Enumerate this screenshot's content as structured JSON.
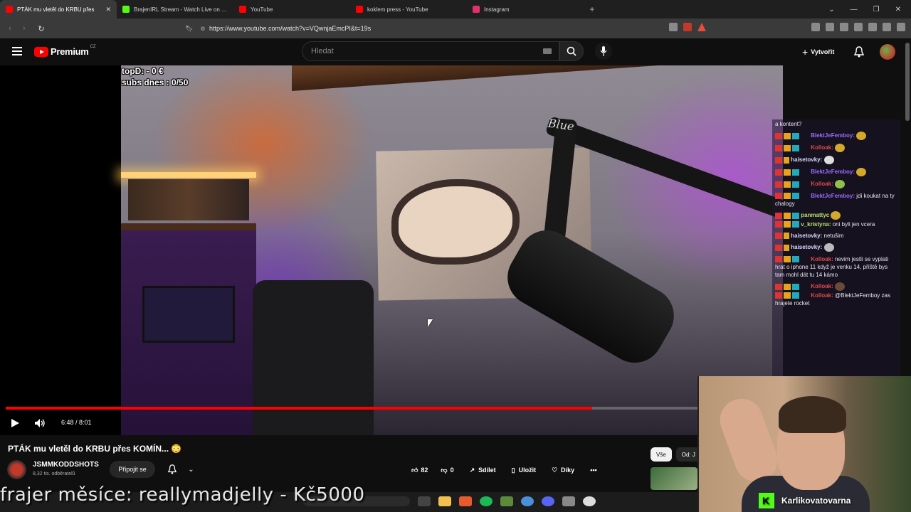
{
  "browser": {
    "tabs": [
      {
        "label": "PTÁK mu vletěl do KRBU přes",
        "favicon_color": "#ff0000",
        "active": true
      },
      {
        "label": "BrajenIRL Stream - Watch Live on Kick",
        "favicon_color": "#53fc18",
        "active": false
      },
      {
        "label": "YouTube",
        "favicon_color": "#ff0000",
        "active": false
      },
      {
        "label": "koklem press - YouTube",
        "favicon_color": "#ff0000",
        "active": false
      },
      {
        "label": "Instagram",
        "favicon_color": "#e1306c",
        "active": false
      }
    ],
    "new_tab": "+",
    "url": "https://www.youtube.com/watch?v=VQwnjaEmcPI&t=19s"
  },
  "header": {
    "brand": "Premium",
    "region": "CZ",
    "search_placeholder": "Hledat",
    "create_label": "Vytvořit"
  },
  "overlay": {
    "line1": "topD: - 0 €",
    "line2": "subs dnes : 0/50"
  },
  "chat": {
    "messages": [
      {
        "user": "",
        "text": "a kontent?",
        "style": "c3"
      },
      {
        "user": "BlektJeFemboy:",
        "text": "",
        "style": ""
      },
      {
        "user": "Kolloak:",
        "text": "",
        "style": "c2"
      },
      {
        "user": "haisetovky:",
        "text": "",
        "style": "c3"
      },
      {
        "user": "BlektJeFemboy:",
        "text": "",
        "style": ""
      },
      {
        "user": "Kolloak:",
        "text": "",
        "style": "c2"
      },
      {
        "user": "BlektJeFemboy:",
        "text": "jdi koukat na ty chalogy",
        "style": ""
      },
      {
        "user": "panmattyc",
        "text": "",
        "style": "c4"
      },
      {
        "user": "v_kristyna:",
        "text": "oni byli jen vcera",
        "style": "c4"
      },
      {
        "user": "haisetovky:",
        "text": "netušim",
        "style": "c3"
      },
      {
        "user": "haisetovky:",
        "text": "",
        "style": "c3"
      },
      {
        "user": "Kolloak:",
        "text": "nevim jestli se vyplati hrat o iphone 11 když je venku 14, příště bys tam mohl dát tu 14 kámo",
        "style": "c2"
      },
      {
        "user": "Kolloak:",
        "text": "",
        "style": "c2"
      },
      {
        "user": "Kolloak:",
        "text": "@BlektJeFemboy zas hrajete rocket",
        "style": "c2"
      }
    ]
  },
  "player": {
    "time": "6:48 / 8:01",
    "progress_fraction": 0.848
  },
  "video": {
    "title": "PTÁK mu vletěl do KRBU přes KOMÍN... 😳",
    "channel": "JSMMKODDSHOTS",
    "subscribers": "8,32 tis. odběratelů",
    "subscribe_label": "Připojit se",
    "likes": "82",
    "dislikes": "0",
    "share_label": "Sdílet",
    "save_label": "Uložit",
    "thanks_label": "Díky",
    "more_label": "•••"
  },
  "filters": {
    "all": "Vše",
    "from": "Od: J"
  },
  "webcam": {
    "streamer": "Karlikovatovarna"
  },
  "ticker": {
    "text": "frajer měsíce: reallymadjelly - Kč5000"
  },
  "colors": {
    "youtube_red": "#ff0000",
    "kick_green": "#53fc18",
    "background": "#0f0f0f"
  }
}
